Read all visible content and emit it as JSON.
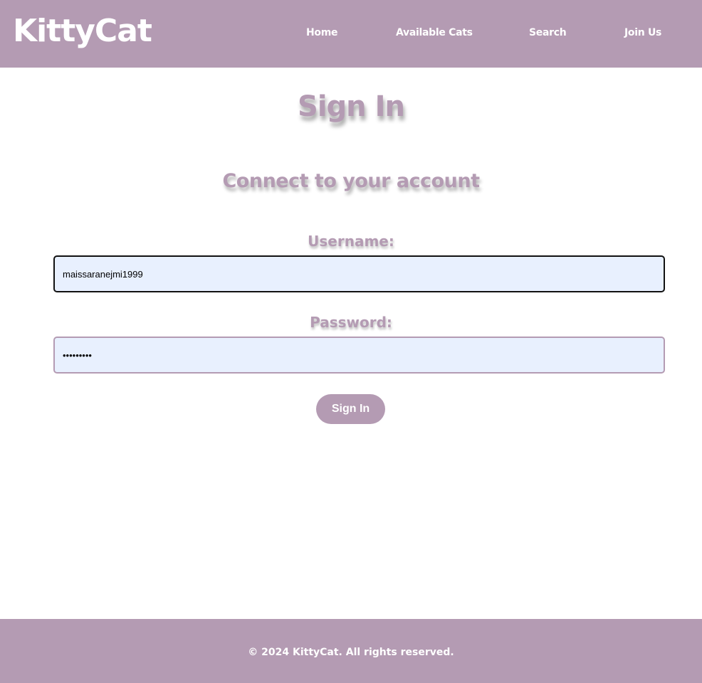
{
  "header": {
    "logo": "KittyCat",
    "nav": {
      "home": "Home",
      "available_cats": "Available Cats",
      "search": "Search",
      "join_us": "Join Us"
    }
  },
  "main": {
    "title": "Sign In",
    "subtitle": "Connect to your account",
    "username": {
      "label": "Username:",
      "value": "maissaranejmi1999"
    },
    "password": {
      "label": "Password:",
      "value": "•••••••••"
    },
    "submit_label": "Sign In"
  },
  "footer": {
    "text": "© 2024 KittyCat. All rights reserved."
  },
  "colors": {
    "brand": "#b49bb3",
    "input_background": "#e8f0fe",
    "focused_border": "#111111"
  }
}
